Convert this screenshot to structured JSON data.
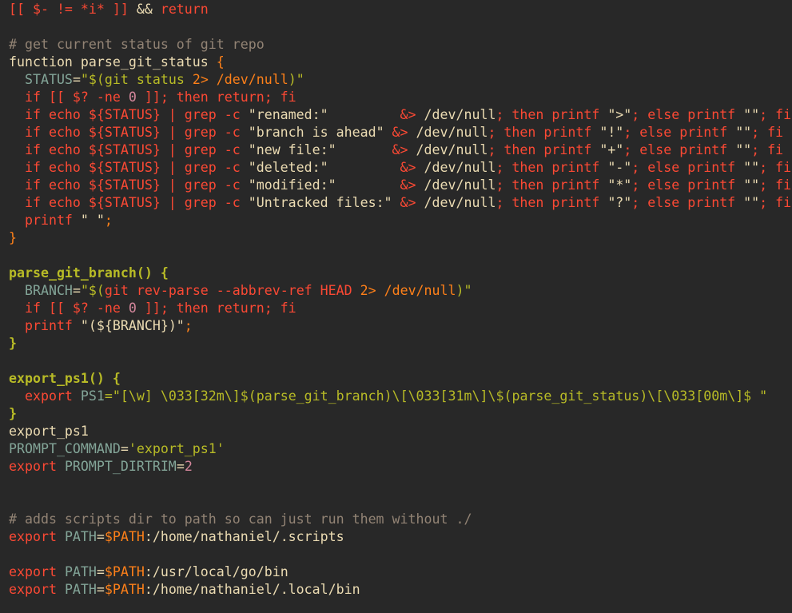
{
  "editor": {
    "background": "#282828",
    "lines": [
      [
        {
          "t": "[[ $- != *i* ]]",
          "c": "keyword"
        },
        {
          "t": " && ",
          "c": "plain"
        },
        {
          "t": "return",
          "c": "keyword"
        }
      ],
      [],
      [
        {
          "t": "# get current status of git repo",
          "c": "comment"
        }
      ],
      [
        {
          "t": "function ",
          "c": "plain"
        },
        {
          "t": "parse_git_status",
          "c": "plain"
        },
        {
          "t": " {",
          "c": "op"
        }
      ],
      [
        {
          "t": "  STATUS",
          "c": "var"
        },
        {
          "t": "=",
          "c": "plain"
        },
        {
          "t": "\"$(",
          "c": "string"
        },
        {
          "t": "git status ",
          "c": "string"
        },
        {
          "t": "2> /dev/null",
          "c": "op"
        },
        {
          "t": ")\"",
          "c": "string"
        }
      ],
      [
        {
          "t": "  if [[ $? -ne ",
          "c": "keyword"
        },
        {
          "t": "0",
          "c": "number"
        },
        {
          "t": " ]]; then return; fi",
          "c": "keyword"
        }
      ],
      [
        {
          "t": "  if echo ${STATUS} | grep -c ",
          "c": "keyword"
        },
        {
          "t": "\"renamed:\"",
          "c": "plain"
        },
        {
          "t": "         &> ",
          "c": "keyword"
        },
        {
          "t": "/dev/null",
          "c": "plain"
        },
        {
          "t": "; then printf ",
          "c": "keyword"
        },
        {
          "t": "\">\"",
          "c": "plain"
        },
        {
          "t": "; else printf ",
          "c": "keyword"
        },
        {
          "t": "\"\"",
          "c": "plain"
        },
        {
          "t": "; fi",
          "c": "keyword"
        }
      ],
      [
        {
          "t": "  if echo ${STATUS} | grep -c ",
          "c": "keyword"
        },
        {
          "t": "\"branch is ahead\"",
          "c": "plain"
        },
        {
          "t": " &> ",
          "c": "keyword"
        },
        {
          "t": "/dev/null",
          "c": "plain"
        },
        {
          "t": "; then printf ",
          "c": "keyword"
        },
        {
          "t": "\"!\"",
          "c": "plain"
        },
        {
          "t": "; else printf ",
          "c": "keyword"
        },
        {
          "t": "\"\"",
          "c": "plain"
        },
        {
          "t": "; fi",
          "c": "keyword"
        }
      ],
      [
        {
          "t": "  if echo ${STATUS} | grep -c ",
          "c": "keyword"
        },
        {
          "t": "\"new file:\"",
          "c": "plain"
        },
        {
          "t": "       &> ",
          "c": "keyword"
        },
        {
          "t": "/dev/null",
          "c": "plain"
        },
        {
          "t": "; then printf ",
          "c": "keyword"
        },
        {
          "t": "\"+\"",
          "c": "plain"
        },
        {
          "t": "; else printf ",
          "c": "keyword"
        },
        {
          "t": "\"\"",
          "c": "plain"
        },
        {
          "t": "; fi",
          "c": "keyword"
        }
      ],
      [
        {
          "t": "  if echo ${STATUS} | grep -c ",
          "c": "keyword"
        },
        {
          "t": "\"deleted:\"",
          "c": "plain"
        },
        {
          "t": "         &> ",
          "c": "keyword"
        },
        {
          "t": "/dev/null",
          "c": "plain"
        },
        {
          "t": "; then printf ",
          "c": "keyword"
        },
        {
          "t": "\"-\"",
          "c": "plain"
        },
        {
          "t": "; else printf ",
          "c": "keyword"
        },
        {
          "t": "\"\"",
          "c": "plain"
        },
        {
          "t": "; fi",
          "c": "keyword"
        }
      ],
      [
        {
          "t": "  if echo ${STATUS} | grep -c ",
          "c": "keyword"
        },
        {
          "t": "\"modified:\"",
          "c": "plain"
        },
        {
          "t": "        &> ",
          "c": "keyword"
        },
        {
          "t": "/dev/null",
          "c": "plain"
        },
        {
          "t": "; then printf ",
          "c": "keyword"
        },
        {
          "t": "\"*\"",
          "c": "plain"
        },
        {
          "t": "; else printf ",
          "c": "keyword"
        },
        {
          "t": "\"\"",
          "c": "plain"
        },
        {
          "t": "; fi",
          "c": "keyword"
        }
      ],
      [
        {
          "t": "  if echo ${STATUS} | grep -c ",
          "c": "keyword"
        },
        {
          "t": "\"Untracked files:\"",
          "c": "plain"
        },
        {
          "t": " &> ",
          "c": "keyword"
        },
        {
          "t": "/dev/null",
          "c": "plain"
        },
        {
          "t": "; then printf ",
          "c": "keyword"
        },
        {
          "t": "\"?\"",
          "c": "plain"
        },
        {
          "t": "; else printf ",
          "c": "keyword"
        },
        {
          "t": "\"\"",
          "c": "plain"
        },
        {
          "t": "; fi",
          "c": "keyword"
        }
      ],
      [
        {
          "t": "  printf ",
          "c": "keyword"
        },
        {
          "t": "\" \"",
          "c": "plain"
        },
        {
          "t": ";",
          "c": "op"
        }
      ],
      [
        {
          "t": "}",
          "c": "op"
        }
      ],
      [],
      [
        {
          "t": "parse_git_branch() {",
          "c": "func"
        }
      ],
      [
        {
          "t": "  BRANCH",
          "c": "var"
        },
        {
          "t": "=",
          "c": "plain"
        },
        {
          "t": "\"$(",
          "c": "string"
        },
        {
          "t": "git rev-parse --abbrev-ref HEAD ",
          "c": "keyword"
        },
        {
          "t": "2> /dev/null",
          "c": "op"
        },
        {
          "t": ")\"",
          "c": "string"
        }
      ],
      [
        {
          "t": "  if [[ $? -ne ",
          "c": "keyword"
        },
        {
          "t": "0",
          "c": "number"
        },
        {
          "t": " ]]; then return; fi",
          "c": "keyword"
        }
      ],
      [
        {
          "t": "  printf ",
          "c": "keyword"
        },
        {
          "t": "\"(${BRANCH})\"",
          "c": "plain"
        },
        {
          "t": ";",
          "c": "op"
        }
      ],
      [
        {
          "t": "}",
          "c": "func"
        }
      ],
      [],
      [
        {
          "t": "export_ps1() {",
          "c": "func"
        }
      ],
      [
        {
          "t": "  export ",
          "c": "keyword"
        },
        {
          "t": "PS1",
          "c": "var"
        },
        {
          "t": "=\"[\\w] \\033[32m\\]$(",
          "c": "string"
        },
        {
          "t": "parse_git_branch",
          "c": "string"
        },
        {
          "t": ")\\[\\033[31m\\]\\$(",
          "c": "string"
        },
        {
          "t": "parse_git_status",
          "c": "string"
        },
        {
          "t": ")\\[\\033[00m\\]$ \"",
          "c": "string"
        }
      ],
      [
        {
          "t": "}",
          "c": "func"
        }
      ],
      [
        {
          "t": "export_ps1",
          "c": "plain"
        }
      ],
      [
        {
          "t": "PROMPT_COMMAND",
          "c": "var"
        },
        {
          "t": "=",
          "c": "plain"
        },
        {
          "t": "'export_ps1'",
          "c": "string"
        }
      ],
      [
        {
          "t": "export ",
          "c": "keyword"
        },
        {
          "t": "PROMPT_DIRTRIM",
          "c": "var"
        },
        {
          "t": "=",
          "c": "plain"
        },
        {
          "t": "2",
          "c": "number"
        }
      ],
      [],
      [],
      [
        {
          "t": "# adds scripts dir to path so can just run them without ./",
          "c": "comment"
        }
      ],
      [
        {
          "t": "export ",
          "c": "keyword"
        },
        {
          "t": "PATH",
          "c": "var"
        },
        {
          "t": "=",
          "c": "plain"
        },
        {
          "t": "$PATH",
          "c": "op"
        },
        {
          "t": ":/home/nathaniel/.scripts",
          "c": "plain"
        }
      ],
      [],
      [
        {
          "t": "export ",
          "c": "keyword"
        },
        {
          "t": "PATH",
          "c": "var"
        },
        {
          "t": "=",
          "c": "plain"
        },
        {
          "t": "$PATH",
          "c": "op"
        },
        {
          "t": ":/usr/local/go/bin",
          "c": "plain"
        }
      ],
      [
        {
          "t": "export ",
          "c": "keyword"
        },
        {
          "t": "PATH",
          "c": "var"
        },
        {
          "t": "=",
          "c": "plain"
        },
        {
          "t": "$PATH",
          "c": "op"
        },
        {
          "t": ":/home/nathaniel/.local/bin",
          "c": "plain"
        }
      ]
    ]
  }
}
